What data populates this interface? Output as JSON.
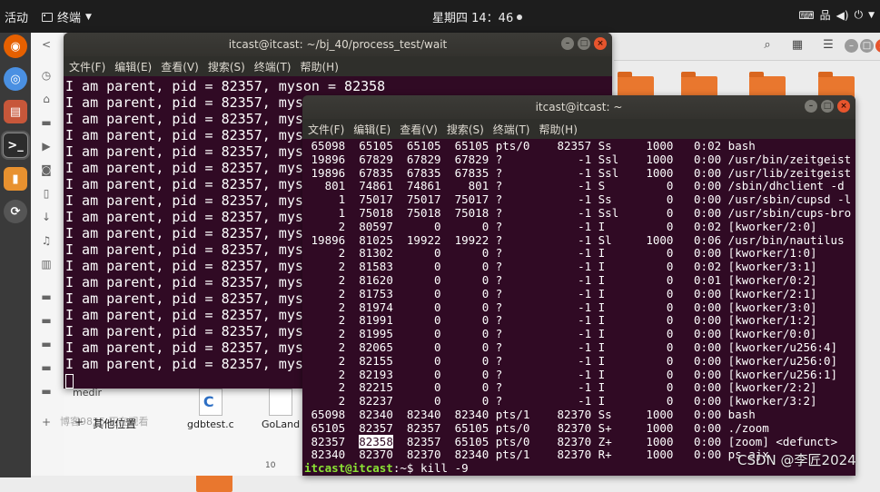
{
  "topbar": {
    "activities": "活动",
    "app_name": "终端",
    "clock": "星期四 14：46"
  },
  "term1": {
    "title": "itcast@itcast: ~/bj_40/process_test/wait",
    "menu": [
      "文件(F)",
      "编辑(E)",
      "查看(V)",
      "搜索(S)",
      "终端(T)",
      "帮助(H)"
    ],
    "first_line": "I am parent, pid = 82357, myson = 82358",
    "repeat_line": "I am parent, pid = 82357, myson",
    "repeat_count": 17
  },
  "term2": {
    "title": "itcast@itcast: ~",
    "menu": [
      "文件(F)",
      "编辑(E)",
      "查看(V)",
      "搜索(S)",
      "终端(T)",
      "帮助(H)"
    ],
    "rows": [
      [
        " 65098",
        " 65105",
        " 65105",
        " 65105",
        "pts/0 ",
        "  82357",
        "Ss  ",
        "  1000",
        "  0:02",
        "bash"
      ],
      [
        " 19896",
        " 67829",
        " 67829",
        " 67829",
        "?     ",
        "     -1",
        "Ssl ",
        "  1000",
        "  0:00",
        "/usr/bin/zeitgeist"
      ],
      [
        " 19896",
        " 67835",
        " 67835",
        " 67835",
        "?     ",
        "     -1",
        "Ssl ",
        "  1000",
        "  0:00",
        "/usr/lib/zeitgeist"
      ],
      [
        "   801",
        " 74861",
        " 74861",
        "   801",
        "?     ",
        "     -1",
        "S   ",
        "     0",
        "  0:00",
        "/sbin/dhclient -d"
      ],
      [
        "     1",
        " 75017",
        " 75017",
        " 75017",
        "?     ",
        "     -1",
        "Ss  ",
        "     0",
        "  0:00",
        "/usr/sbin/cupsd -l"
      ],
      [
        "     1",
        " 75018",
        " 75018",
        " 75018",
        "?     ",
        "     -1",
        "Ssl ",
        "     0",
        "  0:00",
        "/usr/sbin/cups-bro"
      ],
      [
        "     2",
        " 80597",
        "     0",
        "     0",
        "?     ",
        "     -1",
        "I   ",
        "     0",
        "  0:02",
        "[kworker/2:0]"
      ],
      [
        " 19896",
        " 81025",
        " 19922",
        " 19922",
        "?     ",
        "     -1",
        "Sl  ",
        "  1000",
        "  0:06",
        "/usr/bin/nautilus"
      ],
      [
        "     2",
        " 81302",
        "     0",
        "     0",
        "?     ",
        "     -1",
        "I   ",
        "     0",
        "  0:00",
        "[kworker/1:0]"
      ],
      [
        "     2",
        " 81583",
        "     0",
        "     0",
        "?     ",
        "     -1",
        "I   ",
        "     0",
        "  0:02",
        "[kworker/3:1]"
      ],
      [
        "     2",
        " 81620",
        "     0",
        "     0",
        "?     ",
        "     -1",
        "I   ",
        "     0",
        "  0:01",
        "[kworker/0:2]"
      ],
      [
        "     2",
        " 81753",
        "     0",
        "     0",
        "?     ",
        "     -1",
        "I   ",
        "     0",
        "  0:00",
        "[kworker/2:1]"
      ],
      [
        "     2",
        " 81974",
        "     0",
        "     0",
        "?     ",
        "     -1",
        "I   ",
        "     0",
        "  0:00",
        "[kworker/3:0]"
      ],
      [
        "     2",
        " 81991",
        "     0",
        "     0",
        "?     ",
        "     -1",
        "I   ",
        "     0",
        "  0:00",
        "[kworker/1:2]"
      ],
      [
        "     2",
        " 81995",
        "     0",
        "     0",
        "?     ",
        "     -1",
        "I   ",
        "     0",
        "  0:00",
        "[kworker/0:0]"
      ],
      [
        "     2",
        " 82065",
        "     0",
        "     0",
        "?     ",
        "     -1",
        "I   ",
        "     0",
        "  0:00",
        "[kworker/u256:4]"
      ],
      [
        "     2",
        " 82155",
        "     0",
        "     0",
        "?     ",
        "     -1",
        "I   ",
        "     0",
        "  0:00",
        "[kworker/u256:0]"
      ],
      [
        "     2",
        " 82193",
        "     0",
        "     0",
        "?     ",
        "     -1",
        "I   ",
        "     0",
        "  0:00",
        "[kworker/u256:1]"
      ],
      [
        "     2",
        " 82215",
        "     0",
        "     0",
        "?     ",
        "     -1",
        "I   ",
        "     0",
        "  0:00",
        "[kworker/2:2]"
      ],
      [
        "     2",
        " 82237",
        "     0",
        "     0",
        "?     ",
        "     -1",
        "I   ",
        "     0",
        "  0:00",
        "[kworker/3:2]"
      ],
      [
        " 65098",
        " 82340",
        " 82340",
        " 82340",
        "pts/1 ",
        "  82370",
        "Ss  ",
        "  1000",
        "  0:00",
        "bash"
      ],
      [
        " 65105",
        " 82357",
        " 82357",
        " 65105",
        "pts/0 ",
        "  82370",
        "S+  ",
        "  1000",
        "  0:00",
        "./zoom"
      ],
      [
        " 82357",
        " 82358",
        " 82357",
        " 65105",
        "pts/0 ",
        "  82370",
        "Z+  ",
        "  1000",
        "  0:00",
        "[zoom] <defunct>"
      ],
      [
        " 82340",
        " 82370",
        " 82370",
        " 82340",
        "pts/1 ",
        "  82370",
        "R+  ",
        "  1000",
        "  0:00",
        "ps ajx"
      ]
    ],
    "highlight_row": 22,
    "highlight_col": 1,
    "prompt": "itcast@itcast",
    "prompt_rest": ":~$ kill -9"
  },
  "nautilus": {
    "other_locations": "其他位置",
    "mid_label": "medir",
    "notice": "博客9825 正在观看",
    "file1": "gdbtest.c",
    "file2": "GoLand",
    "file3": "10"
  },
  "watermark": "CSDN @李匠2024"
}
